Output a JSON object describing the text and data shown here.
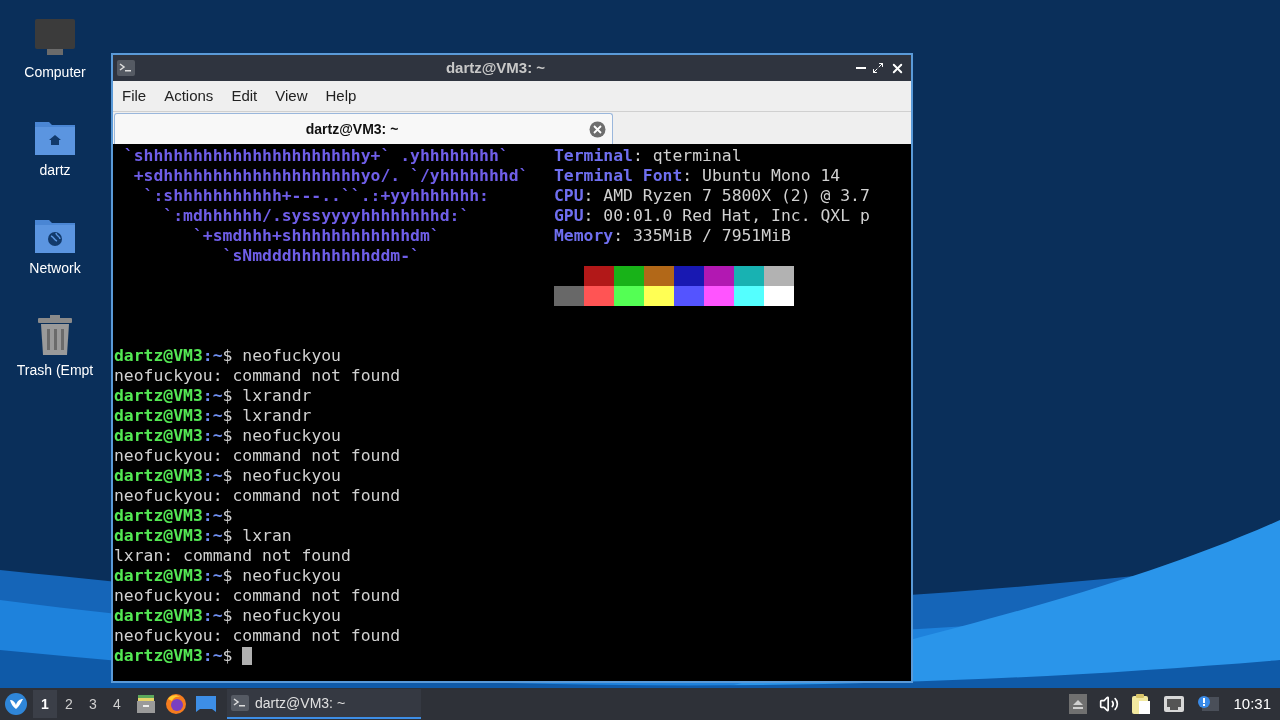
{
  "desktop_icons": [
    {
      "kind": "computer",
      "label": "Computer"
    },
    {
      "kind": "home",
      "label": "dartz"
    },
    {
      "kind": "network",
      "label": "Network"
    },
    {
      "kind": "trash",
      "label": "Trash (Empt"
    }
  ],
  "window": {
    "title": "dartz@VM3: ~",
    "menu": [
      "File",
      "Actions",
      "Edit",
      "View",
      "Help"
    ],
    "tabs": [
      {
        "label": "dartz@VM3: ~",
        "selected": true
      }
    ],
    "terminal": {
      "logo_lines": [
        " `shhhhhhhhhhhhhhhhhhhhhhy+` .yhhhhhhhh`",
        "  +sdhhhhhhhhhhhhhhhhhhhhyo/. `/yhhhhhhhd`",
        "   `:shhhhhhhhhhh+---..``.:+yyhhhhhhh:",
        "     `:mdhhhhhh/.syssyyyyhhhhhhhhd:`",
        "        `+smdhhh+shhhhhhhhhhhhdm`",
        "           `sNmdddhhhhhhhhddm-`"
      ],
      "info": [
        {
          "label": "Terminal",
          "value": ": qterminal"
        },
        {
          "label": "Terminal Font",
          "value": ": Ubuntu Mono 14"
        },
        {
          "label": "CPU",
          "value": ": AMD Ryzen 7 5800X (2) @ 3.7"
        },
        {
          "label": "GPU",
          "value": ": 00:01.0 Red Hat, Inc. QXL p"
        },
        {
          "label": "Memory",
          "value": ": 335MiB / 7951MiB"
        }
      ],
      "palette": [
        [
          {
            "color": "#b21818"
          },
          {
            "color": "#18b218"
          },
          {
            "color": "#b26818"
          },
          {
            "color": "#1818b2"
          },
          {
            "color": "#b218b2"
          },
          {
            "color": "#18b2b2"
          },
          {
            "color": "#b2b2b2"
          }
        ],
        [
          {
            "color": "#686868"
          },
          {
            "color": "#ff5454"
          },
          {
            "color": "#54ff54"
          },
          {
            "color": "#ffff54"
          },
          {
            "color": "#5454ff"
          },
          {
            "color": "#ff54ff"
          },
          {
            "color": "#54ffff"
          },
          {
            "color": "#ffffff"
          }
        ]
      ],
      "history": [
        {
          "kind": "prompt",
          "user_host": "dartz@VM3",
          "path": ":~",
          "symbol": "$",
          "command": "neofuckyou",
          "cursor": false
        },
        {
          "kind": "output",
          "text": "neofuckyou: command not found"
        },
        {
          "kind": "prompt",
          "user_host": "dartz@VM3",
          "path": ":~",
          "symbol": "$",
          "command": "lxrandr",
          "cursor": false
        },
        {
          "kind": "prompt",
          "user_host": "dartz@VM3",
          "path": ":~",
          "symbol": "$",
          "command": "lxrandr",
          "cursor": false
        },
        {
          "kind": "prompt",
          "user_host": "dartz@VM3",
          "path": ":~",
          "symbol": "$",
          "command": "neofuckyou",
          "cursor": false
        },
        {
          "kind": "output",
          "text": "neofuckyou: command not found"
        },
        {
          "kind": "prompt",
          "user_host": "dartz@VM3",
          "path": ":~",
          "symbol": "$",
          "command": "neofuckyou",
          "cursor": false
        },
        {
          "kind": "output",
          "text": "neofuckyou: command not found"
        },
        {
          "kind": "prompt",
          "user_host": "dartz@VM3",
          "path": ":~",
          "symbol": "$",
          "cursor": false
        },
        {
          "kind": "prompt",
          "user_host": "dartz@VM3",
          "path": ":~",
          "symbol": "$",
          "command": "lxran",
          "cursor": false
        },
        {
          "kind": "output",
          "text": "lxran: command not found"
        },
        {
          "kind": "prompt",
          "user_host": "dartz@VM3",
          "path": ":~",
          "symbol": "$",
          "command": "neofuckyou",
          "cursor": false
        },
        {
          "kind": "output",
          "text": "neofuckyou: command not found"
        },
        {
          "kind": "prompt",
          "user_host": "dartz@VM3",
          "path": ":~",
          "symbol": "$",
          "command": "neofuckyou",
          "cursor": false
        },
        {
          "kind": "output",
          "text": "neofuckyou: command not found"
        },
        {
          "kind": "prompt",
          "user_host": "dartz@VM3",
          "path": ":~",
          "symbol": "$",
          "cursor": true
        }
      ]
    }
  },
  "taskbar": {
    "workspaces": [
      {
        "label": "1",
        "selected": true
      },
      {
        "label": "2",
        "selected": false
      },
      {
        "label": "3",
        "selected": false
      },
      {
        "label": "4",
        "selected": false
      }
    ],
    "launchers": [
      {
        "kind": "file-drawer"
      },
      {
        "kind": "browser"
      },
      {
        "kind": "desktop"
      }
    ],
    "tasks": [
      {
        "label": "dartz@VM3: ~",
        "selected": true
      }
    ],
    "tray": [
      {
        "kind": "eject"
      },
      {
        "kind": "volume"
      },
      {
        "kind": "clipboard"
      },
      {
        "kind": "network"
      },
      {
        "kind": "notification"
      }
    ],
    "clock": "10:31"
  }
}
